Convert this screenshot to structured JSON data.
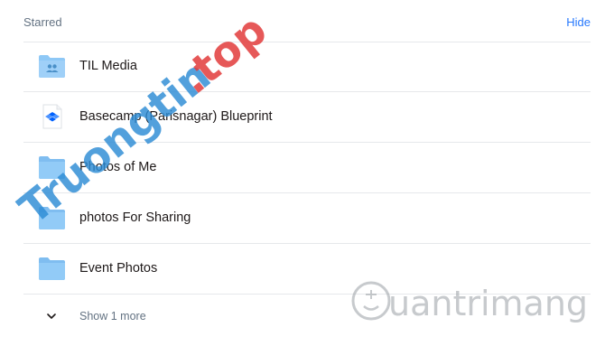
{
  "starred": {
    "title": "Starred",
    "hide_label": "Hide"
  },
  "items": [
    {
      "label": "TIL Media",
      "icon": "shared-folder-icon"
    },
    {
      "label": "Basecamp (Parisnagar) Blueprint",
      "icon": "dropbox-paper-icon"
    },
    {
      "label": "Photos of Me",
      "icon": "folder-icon"
    },
    {
      "label": "photos For Sharing",
      "icon": "folder-icon"
    },
    {
      "label": "Event Photos",
      "icon": "folder-icon"
    }
  ],
  "more": {
    "label": "Show 1 more",
    "icon": "chevron-down-icon"
  },
  "watermarks": {
    "left": "Truongtin.top",
    "right": "uantrimang"
  },
  "colors": {
    "folder": "#8ec8f6",
    "folder_dark": "#6fb6ee",
    "link": "#0061fe",
    "muted": "#637282",
    "divider": "#e6e8eb"
  }
}
